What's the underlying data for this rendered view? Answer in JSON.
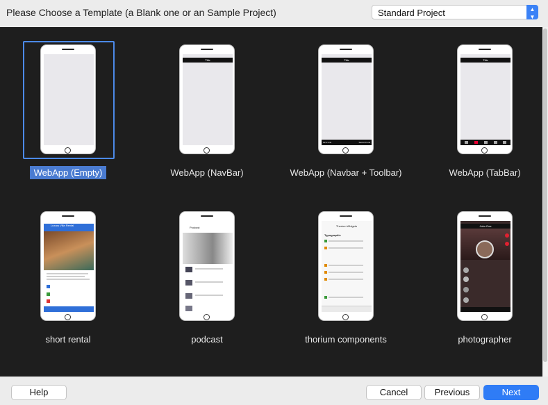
{
  "header": {
    "title": "Please Choose a Template (a Blank one or an Sample Project)",
    "project_type": "Standard Project"
  },
  "templates": [
    {
      "label": "WebApp (Empty)",
      "selected": true
    },
    {
      "label": "WebApp (NavBar)",
      "nav_title": "Title"
    },
    {
      "label": "WebApp (Navbar + Toolbar)",
      "nav_title": "Title",
      "toolbar_left": "First Link",
      "toolbar_right": "Second Link"
    },
    {
      "label": "WebApp (TabBar)",
      "nav_title": "Title"
    },
    {
      "label": "short rental",
      "preview_title": "Luxury Villa Rental"
    },
    {
      "label": "podcast",
      "preview_title": "Podcast"
    },
    {
      "label": "thorium components",
      "preview_title": "Thorium Widgets",
      "section": "Typographie"
    },
    {
      "label": "photographer",
      "preview_title": "John Doe"
    }
  ],
  "footer": {
    "help": "Help",
    "cancel": "Cancel",
    "previous": "Previous",
    "next": "Next"
  },
  "colors": {
    "accent": "#2f7cf6",
    "grid_bg": "#1e1e1e"
  }
}
